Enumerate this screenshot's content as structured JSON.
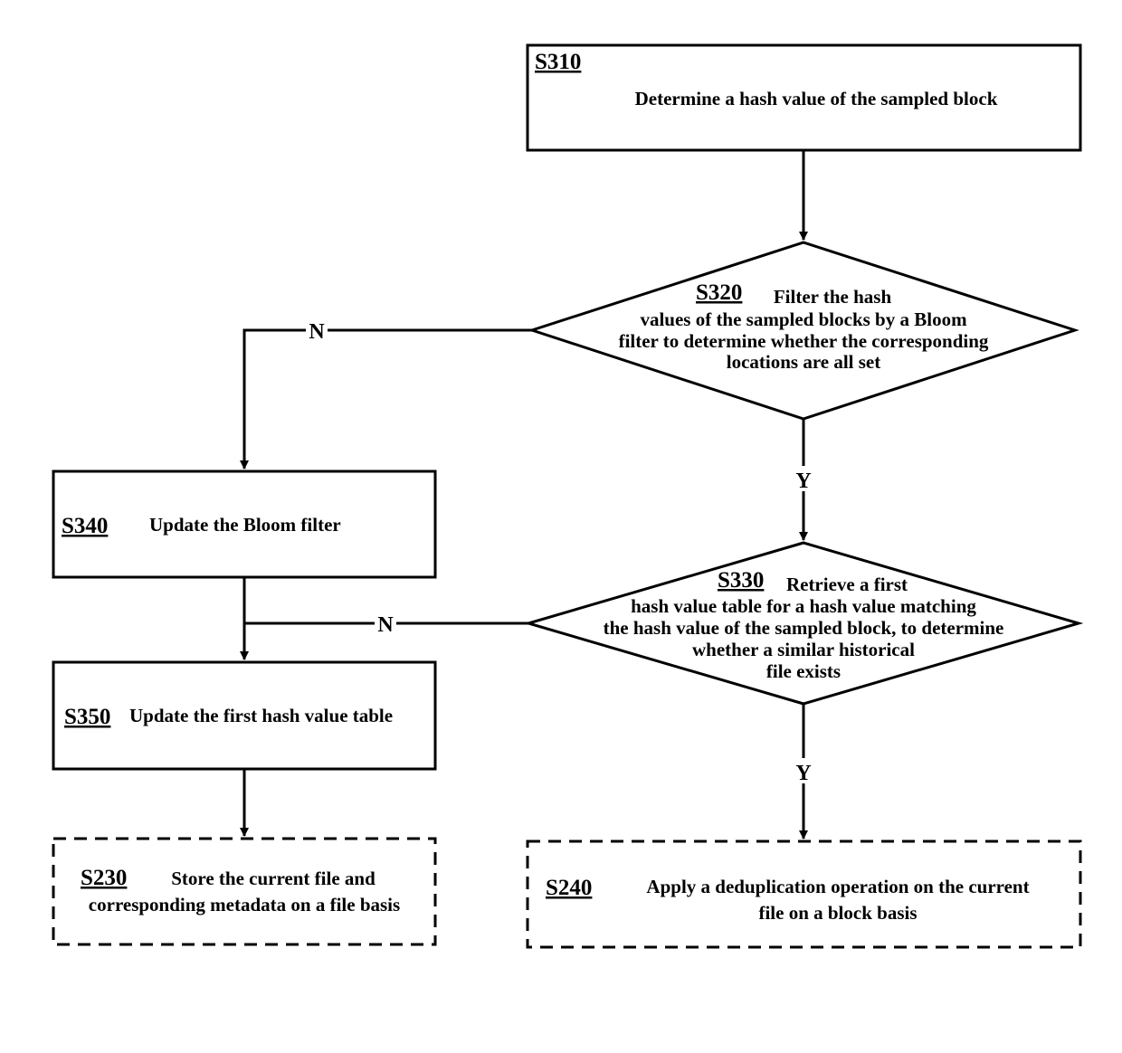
{
  "diagram": {
    "nodes": {
      "s310": {
        "id": "S310",
        "lines": [
          "Determine a hash value of the sampled block"
        ]
      },
      "s320": {
        "id": "S320",
        "lines": [
          "Filter the hash",
          "values of the sampled blocks by a Bloom",
          "filter to determine whether the corresponding",
          "locations are all set"
        ]
      },
      "s330": {
        "id": "S330",
        "lines": [
          "Retrieve a first",
          "hash value table for a hash value matching",
          "the hash value of the sampled block, to determine",
          "whether a similar historical",
          "file exists"
        ]
      },
      "s340": {
        "id": "S340",
        "lines": [
          "Update the Bloom filter"
        ]
      },
      "s350": {
        "id": "S350",
        "lines": [
          "Update the first hash value table"
        ]
      },
      "s230": {
        "id": "S230",
        "lines": [
          "Store the current file and",
          "corresponding metadata on a file basis"
        ]
      },
      "s240": {
        "id": "S240",
        "lines": [
          "Apply a deduplication operation on the current",
          "file on a block basis"
        ]
      }
    },
    "edges": {
      "s320_no": "N",
      "s320_yes": "Y",
      "s330_no": "N",
      "s330_yes": "Y"
    }
  }
}
